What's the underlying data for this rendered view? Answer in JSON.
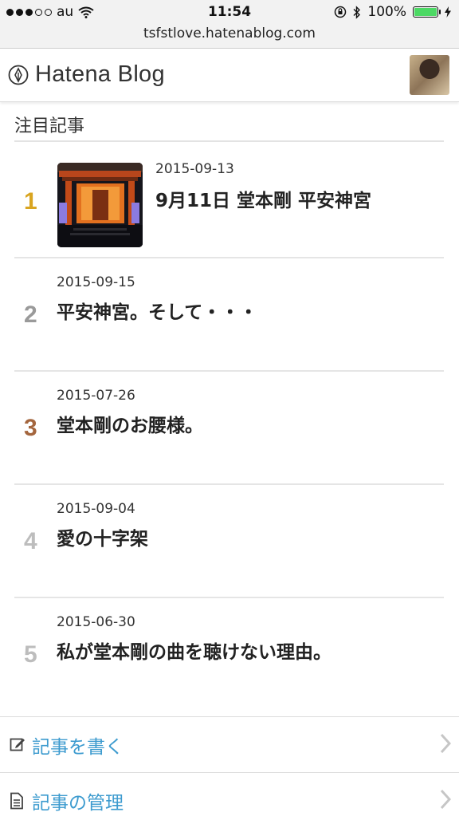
{
  "status_bar": {
    "carrier": "au",
    "time": "11:54",
    "battery": "100%",
    "battery_level": 1.0,
    "battery_color": "#4cd964"
  },
  "url_bar": {
    "url": "tsfstlove.hatenablog.com"
  },
  "header": {
    "logo_text": "Hatena Blog"
  },
  "section": {
    "title": "注目記事"
  },
  "articles": [
    {
      "rank": "1",
      "rank_color": "#d9a521",
      "date": "2015-09-13",
      "title": "9月11日 堂本剛 平安神宮",
      "has_thumbnail": true
    },
    {
      "rank": "2",
      "rank_color": "#9a9a9a",
      "date": "2015-09-15",
      "title": "平安神宮。そして・・・"
    },
    {
      "rank": "3",
      "rank_color": "#a4663e",
      "date": "2015-07-26",
      "title": "堂本剛のお腰様。"
    },
    {
      "rank": "4",
      "rank_color": "#bdbdbd",
      "date": "2015-09-04",
      "title": "愛の十字架"
    },
    {
      "rank": "5",
      "rank_color": "#bdbdbd",
      "date": "2015-06-30",
      "title": "私が堂本剛の曲を聴けない理由。"
    }
  ],
  "menu": {
    "write": {
      "label": "記事を書く",
      "icon": "edit-icon"
    },
    "manage": {
      "label": "記事の管理",
      "icon": "document-icon"
    }
  },
  "colors": {
    "link": "#3d9bcf"
  }
}
